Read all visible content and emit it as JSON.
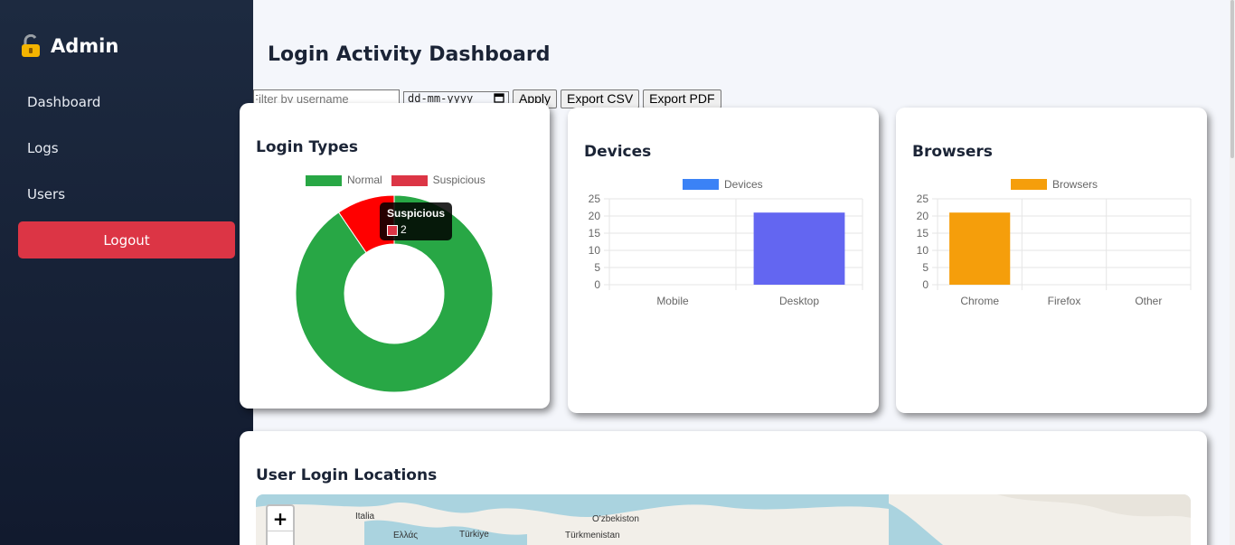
{
  "sidebar": {
    "brand": "Admin",
    "items": [
      {
        "label": "Dashboard"
      },
      {
        "label": "Logs"
      },
      {
        "label": "Users"
      }
    ],
    "logout": "Logout"
  },
  "page": {
    "title": "Login Activity Dashboard"
  },
  "filters": {
    "username_placeholder": "Filter by username",
    "date_placeholder": "dd-mm-yyyy",
    "apply": "Apply",
    "export_csv": "Export CSV",
    "export_pdf": "Export PDF"
  },
  "login_types": {
    "title": "Login Types",
    "tooltip": {
      "title": "Suspicious",
      "value": "2"
    }
  },
  "devices": {
    "title": "Devices"
  },
  "browsers": {
    "title": "Browsers"
  },
  "locations": {
    "title": "User Login Locations",
    "map_labels": [
      "Italia",
      "Ελλάς",
      "Türkiye",
      "O'zbekiston",
      "Türkmenistan"
    ],
    "zoom_in": "+"
  },
  "colors": {
    "normal": "#28a745",
    "suspicious": "#dc3545",
    "devices": "#3b82f6",
    "devices_bar": "#6366f1",
    "browsers": "#f59e0b",
    "logout": "#dc3545"
  },
  "chart_data": [
    {
      "type": "pie",
      "title": "Login Types",
      "categories": [
        "Normal",
        "Suspicious"
      ],
      "values": [
        19,
        2
      ],
      "legend": "top"
    },
    {
      "type": "bar",
      "title": "Devices",
      "categories": [
        "Mobile",
        "Desktop"
      ],
      "series": [
        {
          "name": "Devices",
          "values": [
            0,
            21
          ]
        }
      ],
      "ylim": [
        0,
        25
      ],
      "yticks": [
        0,
        5,
        10,
        15,
        20,
        25
      ],
      "grid": true,
      "legend": "top"
    },
    {
      "type": "bar",
      "title": "Browsers",
      "categories": [
        "Chrome",
        "Firefox",
        "Other"
      ],
      "series": [
        {
          "name": "Browsers",
          "values": [
            21,
            0,
            0
          ]
        }
      ],
      "ylim": [
        0,
        25
      ],
      "yticks": [
        0,
        5,
        10,
        15,
        20,
        25
      ],
      "grid": true,
      "legend": "top"
    }
  ]
}
